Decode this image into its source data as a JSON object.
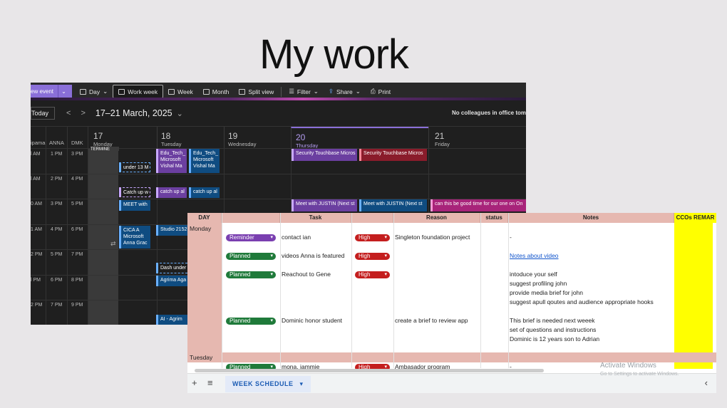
{
  "slide": {
    "title": "My work"
  },
  "calendar": {
    "toolbar": {
      "new_event": "ew event",
      "day": "Day",
      "work_week": "Work week",
      "week": "Week",
      "month": "Month",
      "split_view": "Split view",
      "filter": "Filter",
      "share": "Share",
      "print": "Print"
    },
    "today_label": "Today",
    "prev": "<",
    "next": ">",
    "range": "17–21 March, 2025",
    "no_colleagues": "No colleagues in office tom",
    "timezones": [
      "ipama",
      "ANNA",
      "DMK"
    ],
    "days": [
      {
        "num": "17",
        "name": "Monday"
      },
      {
        "num": "18",
        "name": "Tuesday"
      },
      {
        "num": "19",
        "name": "Wednesday"
      },
      {
        "num": "20",
        "name": "Thursday"
      },
      {
        "num": "21",
        "name": "Friday"
      }
    ],
    "time_rows": [
      [
        "l AM",
        "1 PM",
        "3 PM"
      ],
      [
        "l AM",
        "2 PM",
        "4 PM"
      ],
      [
        "0 AM",
        "3 PM",
        "5 PM"
      ],
      [
        "1 AM",
        "4 PM",
        "6 PM"
      ],
      [
        "2 PM",
        "5 PM",
        "7 PM"
      ],
      [
        "l PM",
        "6 PM",
        "8 PM"
      ],
      [
        "2 PM",
        "7 PM",
        "9 PM"
      ]
    ],
    "events": {
      "mon_under": "under 13 M",
      "mon_catch": "Catch up w",
      "mon_meet": "MEET with",
      "mon_cica": "CICA A",
      "mon_cica2": "Microsoft",
      "mon_cica3": "Anna Grac",
      "mon_top": "TERMINE",
      "tue_edu1": "Edu_Tech_",
      "tue_edu1b": "Microsoft",
      "tue_edu1c": "Vishal Ma",
      "tue_edu2": "Edu_Tech_",
      "tue_edu2b": "Microsoft",
      "tue_edu2c": "Vishal Ma",
      "tue_catch1": "catch up al",
      "tue_catch2": "catch up al",
      "tue_studio": "Studio 2152",
      "tue_dash": "Dash under",
      "tue_agrima": "Agrima Aga",
      "tue_ai": "AI - Agrim",
      "thu_sec1": "Security Touchbase Micros",
      "thu_sec2": "Security Touchbase Micros",
      "thu_justin1": "Meet with JUSTIN (Next st",
      "thu_justin2": "Meet with JUSTIN (Next st",
      "fri_good": "can this be good time for our one on On"
    }
  },
  "sheet": {
    "headers": {
      "day": "DAY",
      "task": "Task",
      "reason": "Reason",
      "status": "status",
      "notes": "Notes",
      "cco": "CCOs REMAR"
    },
    "day_monday": "Monday",
    "day_tuesday": "Tuesday",
    "rows": {
      "r1_chip": "Reminder",
      "r1_task": "contact ian",
      "r1_prio": "High",
      "r1_reason": "Singleton foundation project",
      "r1_notes": "-",
      "r2_chip": "Planned",
      "r2_task": "videos Anna is featured",
      "r2_prio": "High",
      "r2_notes": "Notes about video",
      "r3_chip": "Planned",
      "r3_task": "Reachout to Gene",
      "r3_prio": "High",
      "r3_notes": "intoduce your self",
      "r3_notes2": "suggest profiling john",
      "r3_notes3": "provide media brief for john",
      "r3_notes4": "suggest apull qoutes and audience appropriate hooks",
      "r4_chip": "Planned",
      "r4_task": "Dominic honor student",
      "r4_reason": "create a brief to review app",
      "r4_notes": "This brief is needed next weeek",
      "r4_notes2": "set of questions and instructions",
      "r4_notes3": "Dominic is 12 years son to Adrian",
      "r5_chip": "Planned",
      "r5_task": "mona, jammie",
      "r5_prio": "High",
      "r5_reason": "Ambasador program",
      "r5_notes": "-"
    },
    "footer": {
      "add": "+",
      "menu": "≡",
      "tab": "WEEK SCHEDULE",
      "tab_arrow": "▾",
      "scroll_left": "‹"
    }
  },
  "watermark": {
    "line1": "Activate Windows",
    "line2": "Go to Settings to activate Windows."
  }
}
